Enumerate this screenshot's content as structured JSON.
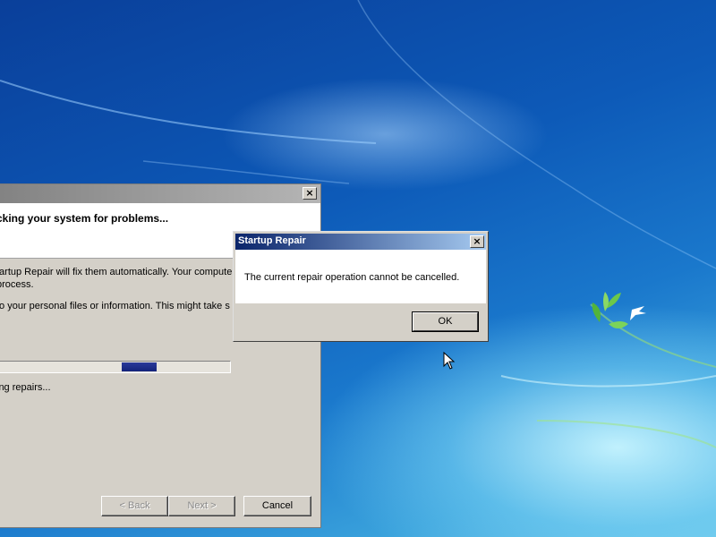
{
  "desktop": {
    "background_theme": "Windows 7 default wallpaper"
  },
  "main_window": {
    "close_glyph": "×",
    "header_title": "cking your system for problems...",
    "body_lines": [
      "tartup Repair will fix them automatically. Your compute",
      "process.",
      "to your personal files or information. This might take s"
    ],
    "progress_fraction": 0.15,
    "status_text": "ing repairs...",
    "buttons": {
      "back": "< Back",
      "next": "Next >",
      "cancel": "Cancel"
    }
  },
  "dialog": {
    "title": "Startup Repair",
    "close_glyph": "×",
    "message": "The current repair operation cannot be cancelled.",
    "ok_label": "OK"
  },
  "colors": {
    "dialog_titlebar": "#0a246a",
    "progress_fill": "#13237a",
    "window_face": "#d4d0c8"
  },
  "icons": {
    "cursor": "arrow-cursor-icon",
    "close": "close-icon",
    "wallpaper_logo": "bird-leaf-logo"
  }
}
